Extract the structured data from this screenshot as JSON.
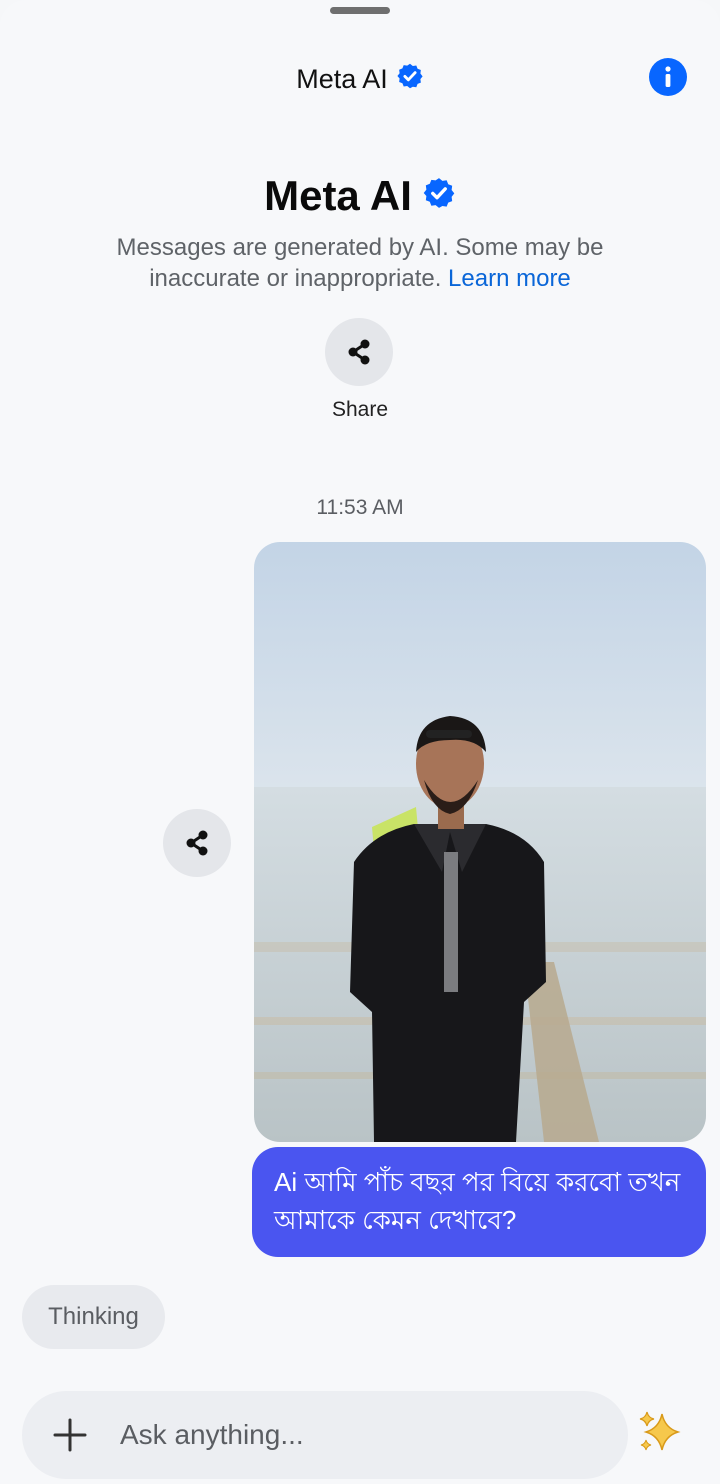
{
  "header": {
    "title": "Meta AI",
    "icons": {
      "verified": "verified-badge-icon",
      "info": "info-icon"
    }
  },
  "intro": {
    "title": "Meta AI",
    "disclaimer": "Messages are generated by AI. Some may be inaccurate or inappropriate.",
    "learn_more": "Learn more",
    "share_label": "Share"
  },
  "conversation": {
    "timestamp": "11:53 AM",
    "user_message": "Ai আমি পাঁচ বছর পর বিয়ে করবো তখন আমাকে কেমন দেখাবে?",
    "ai_status": "Thinking"
  },
  "composer": {
    "placeholder": "Ask anything...",
    "icons": {
      "add": "plus-icon",
      "imagine": "sparkle-icon"
    }
  },
  "colors": {
    "accent": "#0866ff",
    "user_bubble": "#4a55f0",
    "link": "#0a66d8",
    "background": "#f7f8fa"
  }
}
